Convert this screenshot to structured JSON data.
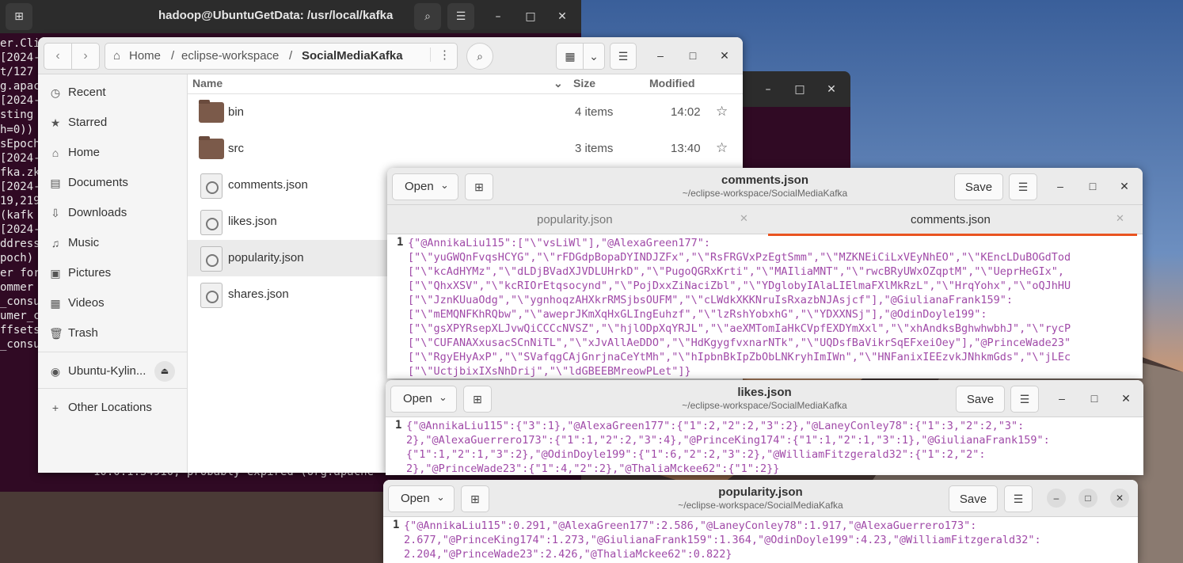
{
  "terminal": {
    "title": "hadoop@UbuntuGetData: /usr/local/kafka",
    "lines": [
      "er.Cli",
      "[2024-",
      "t/127",
      "g.apac",
      "[2024-",
      "sting",
      "h=0))",
      "sEpoch",
      "[2024-",
      "fka.zk",
      "[2024-",
      "19,219",
      " (kafk",
      "[2024-",
      "ddress",
      "poch)",
      "er for",
      " ommer",
      "_consu",
      "umer_c",
      "ffsets",
      "_consu"
    ],
    "tail": "10.0.1:54910, probably expired (org.apache"
  },
  "files": {
    "nav": {
      "back": "‹",
      "forward": "›"
    },
    "path": {
      "home": "Home",
      "sep": "/",
      "p1": "eclipse-workspace",
      "p2": "SocialMediaKafka"
    },
    "sidebar": [
      {
        "label": "Recent",
        "icon": "clock-icon",
        "glyph": "◷"
      },
      {
        "label": "Starred",
        "icon": "star-icon",
        "glyph": "★"
      },
      {
        "label": "Home",
        "icon": "home-icon",
        "glyph": "⌂"
      },
      {
        "label": "Documents",
        "icon": "document-icon",
        "glyph": "▤"
      },
      {
        "label": "Downloads",
        "icon": "download-icon",
        "glyph": "⇩"
      },
      {
        "label": "Music",
        "icon": "music-icon",
        "glyph": "♫"
      },
      {
        "label": "Pictures",
        "icon": "picture-icon",
        "glyph": "▣"
      },
      {
        "label": "Videos",
        "icon": "video-icon",
        "glyph": "▦"
      },
      {
        "label": "Trash",
        "icon": "trash-icon",
        "glyph": "🗑"
      },
      {
        "label": "Ubuntu-Kylin...",
        "icon": "disc-icon",
        "glyph": "◉"
      },
      {
        "label": "Other Locations",
        "icon": "plus-icon",
        "glyph": "+"
      }
    ],
    "columns": {
      "name": "Name",
      "size": "Size",
      "modified": "Modified"
    },
    "rows": [
      {
        "name": "bin",
        "size": "4 items",
        "modified": "14:02",
        "kind": "folder"
      },
      {
        "name": "src",
        "size": "3 items",
        "modified": "13:40",
        "kind": "folder"
      },
      {
        "name": "comments.json",
        "size": "",
        "modified": "",
        "kind": "file"
      },
      {
        "name": "likes.json",
        "size": "",
        "modified": "",
        "kind": "file"
      },
      {
        "name": "popularity.json",
        "size": "",
        "modified": "",
        "kind": "file"
      },
      {
        "name": "shares.json",
        "size": "",
        "modified": "",
        "kind": "file"
      }
    ]
  },
  "editor_common": {
    "open": "Open",
    "save": "Save",
    "subtitle": "~/eclipse-workspace/SocialMediaKafka",
    "line1": "1"
  },
  "comments_editor": {
    "title": "comments.json",
    "tabs": [
      "popularity.json",
      "comments.json"
    ],
    "code": [
      "{\"@AnnikaLiu115\":[\"\\\"vsLiWl\"],\"@AlexaGreen177\":",
      "[\"\\\"yuGWQnFvqsHCYG\",\"\\\"rFDGdpBopaDYINDJZFx\",\"\\\"RsFRGVxPzEgtSmm\",\"\\\"MZKNEiCiLxVEyNhEO\",\"\\\"KEncLDuBOGdTod",
      "[\"\\\"kcAdHYMz\",\"\\\"dLDjBVadXJVDLUHrkD\",\"\\\"PugoQGRxKrti\",\"\\\"MAIliaMNT\",\"\\\"rwcBRyUWxOZqptM\",\"\\\"UeprHeGIx\",",
      "[\"\\\"QhxXSV\",\"\\\"kcRIOrEtqsocynd\",\"\\\"PojDxxZiNaciZbl\",\"\\\"YDglobyIAlaLIElmaFXlMkRzL\",\"\\\"HrqYohx\",\"\\\"oQJhHU",
      "[\"\\\"JznKUuaOdg\",\"\\\"ygnhoqzAHXkrRMSjbsOUFM\",\"\\\"cLWdkXKKNruIsRxazbNJAsjcf\"],\"@GiulianaFrank159\":",
      "[\"\\\"mEMQNFKhRQbw\",\"\\\"aweprJKmXqHxGLIngEuhzf\",\"\\\"lzRshYobxhG\",\"\\\"YDXXNSj\"],\"@OdinDoyle199\":",
      "[\"\\\"gsXPYRsepXLJvwQiCCCcNVSZ\",\"\\\"hjlODpXqYRJL\",\"\\\"aeXMTomIaHkCVpfEXDYmXxl\",\"\\\"xhAndksBghwhwbhJ\",\"\\\"rycP",
      "[\"\\\"CUFANAXxusacSCnNiTL\",\"\\\"xJvAllAeDDO\",\"\\\"HdKgygfvxnarNTk\",\"\\\"UQDsfBaVikrSqEFxeiOey\"],\"@PrinceWade23\"",
      "[\"\\\"RgyEHyAxP\",\"\\\"SVafqgCAjGnrjnaCeYtMh\",\"\\\"hIpbnBkIpZbObLNKryhImIWn\",\"\\\"HNFanixIEEzvkJNhkmGds\",\"\\\"jLEc",
      "[\"\\\"UctjbixIXsNhDrij\",\"\\\"ldGBEEBMreowPLet\"]}"
    ]
  },
  "likes_editor": {
    "title": "likes.json",
    "code": [
      "{\"@AnnikaLiu115\":{\"3\":1},\"@AlexaGreen177\":{\"1\":2,\"2\":2,\"3\":2},\"@LaneyConley78\":{\"1\":3,\"2\":2,\"3\":",
      "2},\"@AlexaGuerrero173\":{\"1\":1,\"2\":2,\"3\":4},\"@PrinceKing174\":{\"1\":1,\"2\":1,\"3\":1},\"@GiulianaFrank159\":",
      "{\"1\":1,\"2\":1,\"3\":2},\"@OdinDoyle199\":{\"1\":6,\"2\":2,\"3\":2},\"@WilliamFitzgerald32\":{\"1\":2,\"2\":",
      "2},\"@PrinceWade23\":{\"1\":4,\"2\":2},\"@ThaliaMckee62\":{\"1\":2}}"
    ]
  },
  "popularity_editor": {
    "title": "popularity.json",
    "code": [
      "{\"@AnnikaLiu115\":0.291,\"@AlexaGreen177\":2.586,\"@LaneyConley78\":1.917,\"@AlexaGuerrero173\":",
      "2.677,\"@PrinceKing174\":1.273,\"@GiulianaFrank159\":1.364,\"@OdinDoyle199\":4.23,\"@WilliamFitzgerald32\":",
      "2.204,\"@PrinceWade23\":2.426,\"@ThaliaMckee62\":0.822}"
    ]
  },
  "colors": {
    "terminal_bg": "#300a24",
    "accent": "#e95420",
    "json_text": "#a04aa8",
    "folder": "#7b5a4a"
  }
}
